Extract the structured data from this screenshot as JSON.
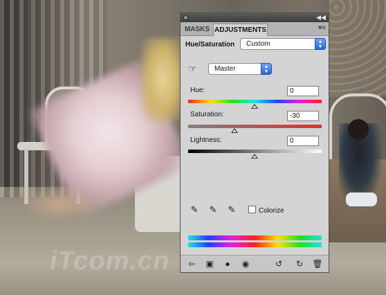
{
  "panel": {
    "tabs": [
      {
        "label": "MASKS"
      },
      {
        "label": "ADJUSTMENTS"
      }
    ],
    "title": "Hue/Saturation",
    "preset": "Custom",
    "channel": "Master",
    "hue": {
      "label": "Hue:",
      "value": "0",
      "level": 0.5
    },
    "saturation": {
      "label": "Saturation:",
      "value": "-30",
      "level": 0.35
    },
    "lightness": {
      "label": "Lightness:",
      "value": "0",
      "level": 0.5
    },
    "colorize_label": "Colorize"
  },
  "watermark": "iTcom.cn"
}
